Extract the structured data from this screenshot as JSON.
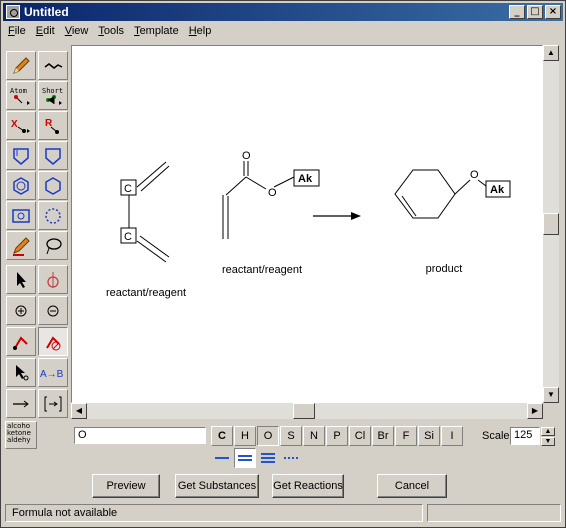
{
  "window": {
    "title": "Untitled"
  },
  "menu": [
    "File",
    "Edit",
    "View",
    "Tools",
    "Template",
    "Help"
  ],
  "toolbox": {
    "atom_label": "Atom",
    "short_label": "Short",
    "x_label": "X",
    "r_label": "R",
    "ab_label": "A→B",
    "templates_label": "alcoho ketone aldehy"
  },
  "drawing": {
    "reactant1": {
      "atoms": [
        "C",
        "C"
      ],
      "caption": "reactant/reagent"
    },
    "reactant2": {
      "atoms": [
        "O",
        "O",
        "Ak"
      ],
      "caption": "reactant/reagent"
    },
    "product": {
      "atoms": [
        "O",
        "Ak"
      ],
      "caption": "product"
    }
  },
  "atom_input": {
    "value": "O"
  },
  "elements": [
    "C",
    "H",
    "O",
    "S",
    "N",
    "P",
    "Cl",
    "Br",
    "F",
    "Si",
    "I"
  ],
  "selected_element": "O",
  "scale": {
    "label": "Scale",
    "value": "125"
  },
  "buttons": {
    "preview": "Preview",
    "get_substances": "Get Substances",
    "get_reactions": "Get Reactions",
    "cancel": "Cancel"
  },
  "status": {
    "text": "Formula not available"
  },
  "colors": {
    "titlebar": "#0a246a",
    "bond_blue": "#2255cc"
  }
}
